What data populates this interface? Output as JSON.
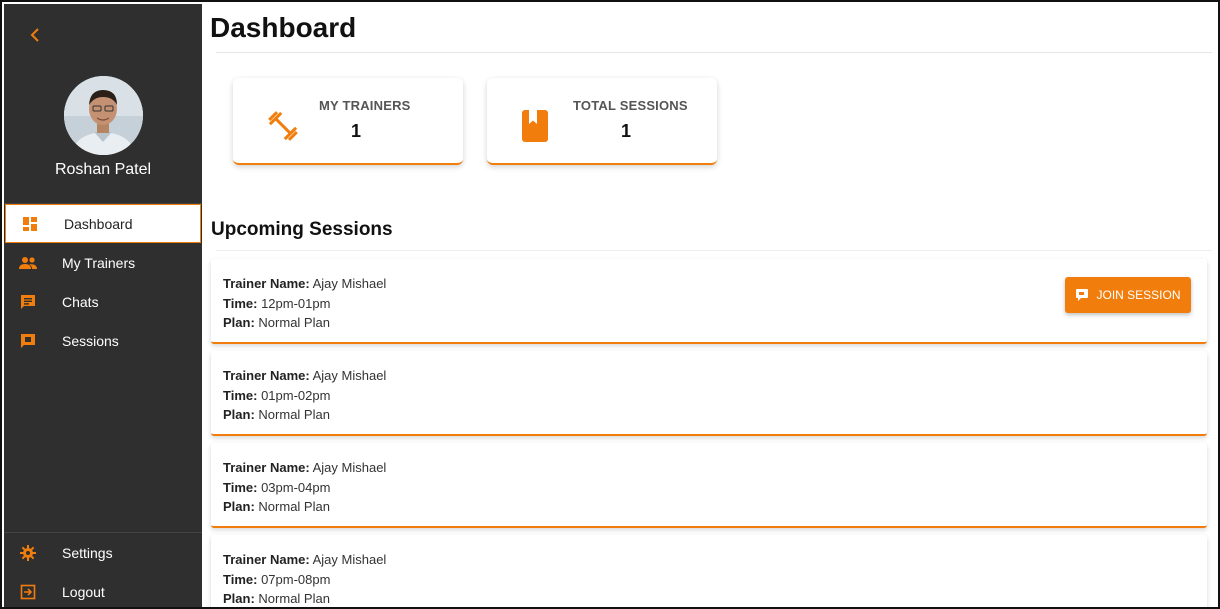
{
  "app": {
    "accent": "#f07d0c",
    "sidebar_bg": "#2f2f2f"
  },
  "sidebar": {
    "back_icon": "chevron-left-icon",
    "user": {
      "name": "Roshan Patel"
    },
    "items": [
      {
        "label": "Dashboard",
        "icon": "dashboard-icon",
        "active": true
      },
      {
        "label": "My Trainers",
        "icon": "people-icon"
      },
      {
        "label": "Chats",
        "icon": "chat-icon"
      },
      {
        "label": "Sessions",
        "icon": "sessions-icon"
      }
    ],
    "bottom_items": [
      {
        "label": "Settings",
        "icon": "gear-icon"
      },
      {
        "label": "Logout",
        "icon": "logout-icon"
      }
    ]
  },
  "main": {
    "title": "Dashboard",
    "stats": [
      {
        "title": "MY TRAINERS",
        "value": "1",
        "icon": "dumbbell-icon"
      },
      {
        "title": "TOTAL SESSIONS",
        "value": "1",
        "icon": "bookmark-book-icon"
      }
    ],
    "upcoming": {
      "title": "Upcoming Sessions",
      "labels": {
        "trainer": "Trainer Name:",
        "time": "Time:",
        "plan": "Plan:"
      },
      "join_label": "JOIN SESSION",
      "sessions": [
        {
          "trainer": "Ajay Mishael",
          "time": "12pm-01pm",
          "plan": "Normal Plan"
        },
        {
          "trainer": "Ajay Mishael",
          "time": "01pm-02pm",
          "plan": "Normal Plan"
        },
        {
          "trainer": "Ajay Mishael",
          "time": "03pm-04pm",
          "plan": "Normal Plan"
        },
        {
          "trainer": "Ajay Mishael",
          "time": "07pm-08pm",
          "plan": "Normal Plan"
        }
      ]
    }
  }
}
